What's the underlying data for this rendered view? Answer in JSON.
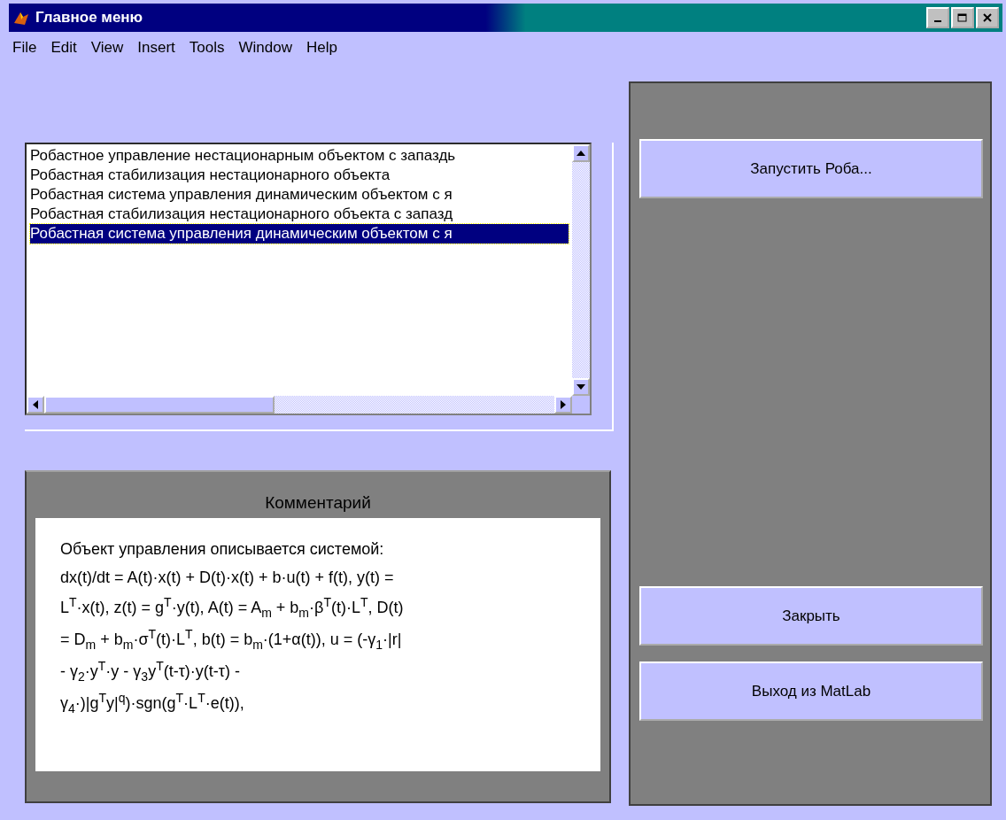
{
  "window": {
    "title": "Главное меню"
  },
  "menu": [
    "File",
    "Edit",
    "View",
    "Insert",
    "Tools",
    "Window",
    "Help"
  ],
  "list": {
    "items": [
      {
        "label": "Робастное управление нестационарным объектом с запаздь",
        "selected": false
      },
      {
        "label": "Робастная стабилизация нестационарного объекта",
        "selected": false
      },
      {
        "label": "Робастная система управления динамическим объектом с я",
        "selected": false
      },
      {
        "label": "Робастная стабилизация нестационарного объекта с запазд",
        "selected": false
      },
      {
        "label": "Робастная система управления динамическим объектом с я",
        "selected": true
      }
    ]
  },
  "comment": {
    "title": "Комментарий",
    "lines": [
      "Объект управления описывается системой:",
      "dx(t)/dt = A(t)·x(t) + D(t)·x(t) + b·u(t) + f(t), y(t) =",
      "L$^{T}$·x(t), z(t) = g$^{T}$·y(t), A(t) = A$_{m}$ + b$_{m}$·β$^{T}$(t)·L$^{T}$, D(t)",
      "= D$_{m}$ + b$_{m}$·σ$^{T}$(t)·L$^{T}$, b(t) = b$_{m}$·(1+α(t)), u = (-γ$_{1}$·|r|",
      "- γ$_{2}$·y$^{T}$·y - γ$_{3}$y$^{T}$(t-τ)·y(t-τ) -",
      "γ$_{4}$·)|g$^{T}$y|$^{q}$)·sgn(g$^{T}$·L$^{T}$·e(t)),"
    ]
  },
  "buttons": [
    {
      "label": "Запустить Роба...",
      "kind": "top"
    },
    {
      "label": "Закрыть",
      "kind": "bottom"
    },
    {
      "label": "Выход из MatLab",
      "kind": "bottom"
    }
  ]
}
